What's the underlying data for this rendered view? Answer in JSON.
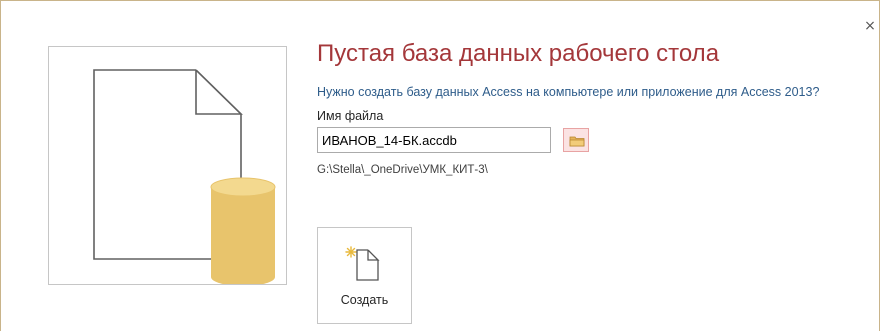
{
  "dialog": {
    "close_glyph": "×",
    "title": "Пустая база данных рабочего стола",
    "subtitle": "Нужно создать базу данных Access на компьютере или приложение для Access 2013?",
    "file_label": "Имя файла",
    "file_name": "ИВАНОВ_14-БК.accdb",
    "path": "G:\\Stella\\_OneDrive\\УМК_КИТ-3\\",
    "create_label": "Создать"
  },
  "icons": {
    "preview": "blank-database-document-icon",
    "browse": "folder-icon",
    "create": "new-document-icon",
    "close": "close-icon"
  },
  "colors": {
    "title": "#a4373a",
    "subtitle": "#2e5c8a",
    "database_cylinder": "#e8c46c",
    "browse_button_bg": "#fbe3e3"
  }
}
